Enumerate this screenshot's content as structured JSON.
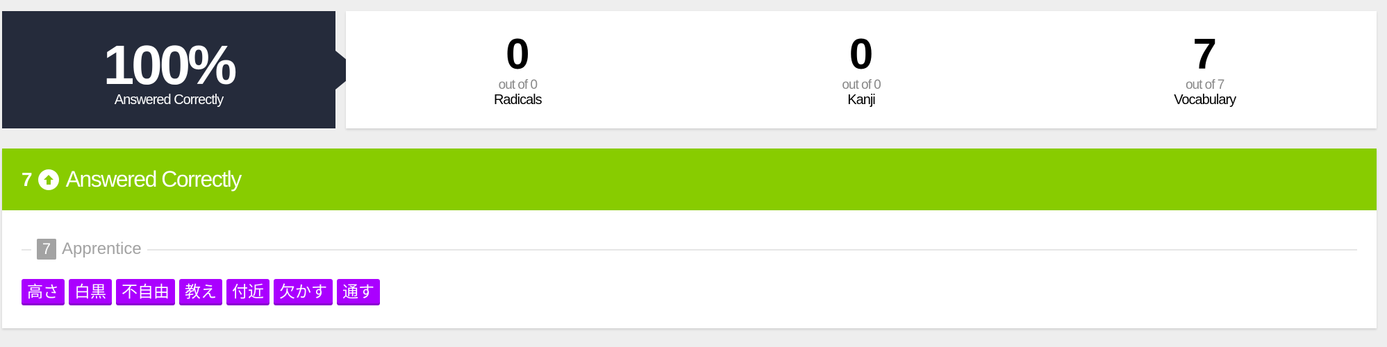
{
  "summary": {
    "score_percent": "100%",
    "score_label": "Answered Correctly",
    "stats": [
      {
        "count": "0",
        "out_of": "out of 0",
        "name": "Radicals"
      },
      {
        "count": "0",
        "out_of": "out of 0",
        "name": "Kanji"
      },
      {
        "count": "7",
        "out_of": "out of 7",
        "name": "Vocabulary"
      }
    ]
  },
  "results": {
    "count": "7",
    "icon": "arrow-up-circle-icon",
    "title": "Answered Correctly",
    "header_color": "#88cc00",
    "srs_group": {
      "count": "7",
      "name": "Apprentice"
    },
    "item_color": "#aa00ff",
    "items": [
      "高さ",
      "白黒",
      "不自由",
      "教え",
      "付近",
      "欠かす",
      "通す"
    ]
  }
}
